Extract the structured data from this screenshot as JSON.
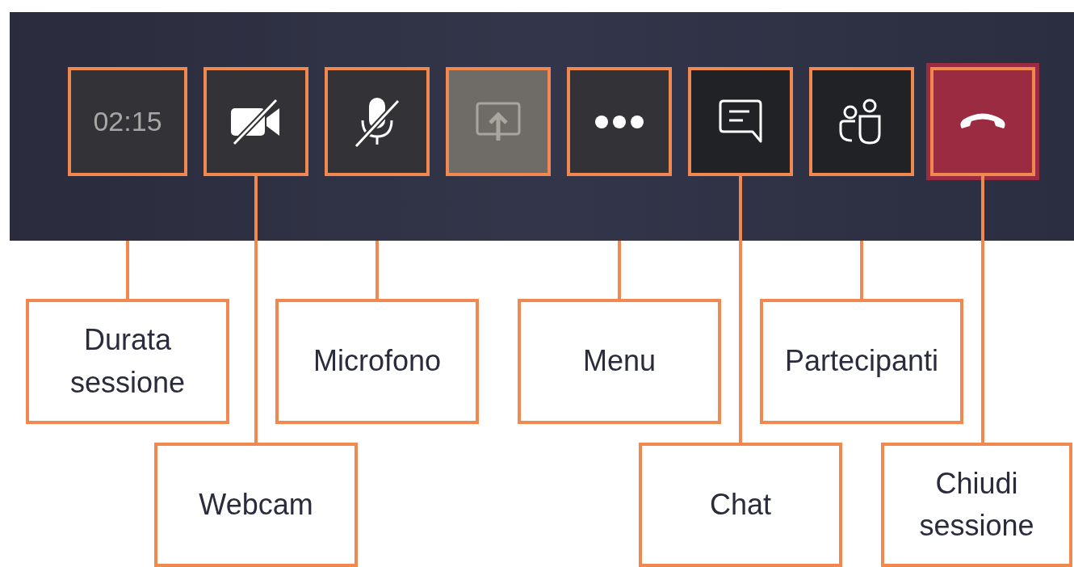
{
  "toolbar": {
    "timer": "02:15",
    "buttons": [
      {
        "kind": "camera",
        "muted": true
      },
      {
        "kind": "microphone",
        "muted": true
      },
      {
        "kind": "share",
        "disabled": true
      },
      {
        "kind": "more"
      },
      {
        "kind": "chat"
      },
      {
        "kind": "participants"
      },
      {
        "kind": "hang-up"
      }
    ]
  },
  "callouts": [
    "Durata sessione",
    "Webcam",
    "Microfono",
    "Menu",
    "Chat",
    "Partecipanti",
    "Chiudi sessione"
  ]
}
